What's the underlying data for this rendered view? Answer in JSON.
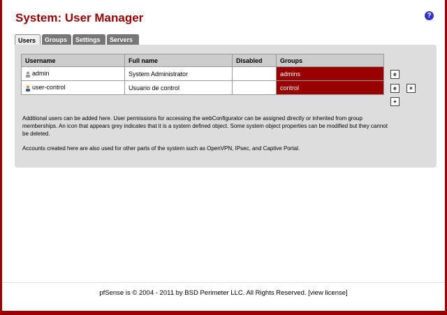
{
  "page": {
    "title": "System: User Manager"
  },
  "tabs": [
    {
      "label": "Users",
      "active": true
    },
    {
      "label": "Groups",
      "active": false
    },
    {
      "label": "Settings",
      "active": false
    },
    {
      "label": "Servers",
      "active": false
    }
  ],
  "table": {
    "headers": [
      "Username",
      "Full name",
      "Disabled",
      "Groups"
    ],
    "rows": [
      {
        "username": "admin",
        "fullname": "System Administrator",
        "disabled": "",
        "groups": "admins",
        "system": true
      },
      {
        "username": "user-control",
        "fullname": "Usuario de control",
        "disabled": "",
        "groups": "control",
        "system": false
      }
    ]
  },
  "info": {
    "p1": "Additional users can be added here. User permissions for accessing the webConfigurator can be assigned directly or inherited from group memberships. An icon that appears grey indicates that it is a system defined object. Some system object properties can be modified but they cannot be deleted.",
    "p2": "Accounts created here are also used for other parts of the system such as OpenVPN, IPsec, and Captive Portal."
  },
  "footer": {
    "text": "pfSense is © 2004 - 2011 by BSD Perimeter LLC. All Rights Reserved. [",
    "link": "view license",
    "close": "]"
  },
  "colors": {
    "brand": "#990000",
    "group_cell": "#990000",
    "panel": "#dddddd",
    "help": "#3333cc"
  }
}
